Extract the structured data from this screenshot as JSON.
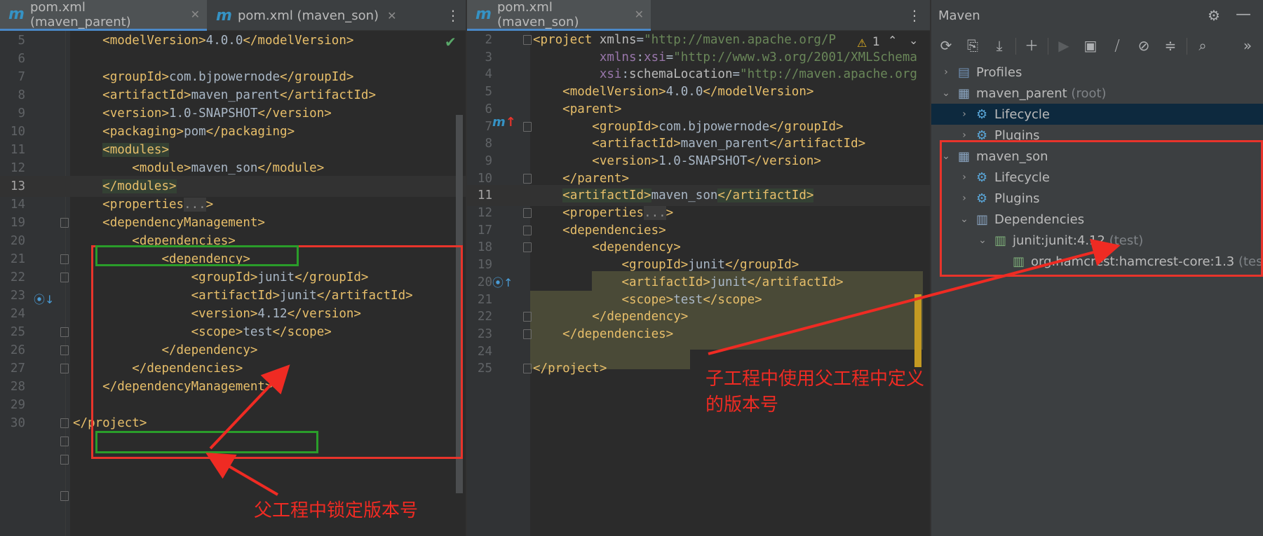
{
  "left_pane": {
    "tabs": [
      {
        "label": "pom.xml (maven_parent)",
        "active": true
      },
      {
        "label": "pom.xml (maven_son)",
        "active": false
      }
    ],
    "lines": [
      {
        "n": "5",
        "html": "    <span class=\"t-tag\">&lt;modelVersion&gt;</span>4.0.0<span class=\"t-tag\">&lt;/modelVersion&gt;</span>"
      },
      {
        "n": "6",
        "html": ""
      },
      {
        "n": "7",
        "html": "    <span class=\"t-tag\">&lt;groupId&gt;</span>com.bjpowernode<span class=\"t-tag\">&lt;/groupId&gt;</span>"
      },
      {
        "n": "8",
        "html": "    <span class=\"t-tag\">&lt;artifactId&gt;</span>maven_parent<span class=\"t-tag\">&lt;/artifactId&gt;</span>"
      },
      {
        "n": "9",
        "html": "    <span class=\"t-tag\">&lt;version&gt;</span>1.0-SNAPSHOT<span class=\"t-tag\">&lt;/version&gt;</span>"
      },
      {
        "n": "10",
        "html": "    <span class=\"t-tag\">&lt;packaging&gt;</span>pom<span class=\"t-tag\">&lt;/packaging&gt;</span>"
      },
      {
        "n": "11",
        "html": "    <span class=\"t-tag t-hl\">&lt;modules&gt;</span>"
      },
      {
        "n": "12",
        "html": "        <span class=\"t-tag\">&lt;module&gt;</span>maven_son<span class=\"t-tag\">&lt;/module&gt;</span>"
      },
      {
        "n": "13",
        "html": "    <span class=\"t-tag t-hl\">&lt;/modules&gt;</span>",
        "current": true
      },
      {
        "n": "14",
        "html": "    <span class=\"t-tag\">&lt;properties</span><span class=\"t-fold\">...</span><span class=\"t-tag\">&gt;</span>"
      },
      {
        "n": "19",
        "html": "    <span class=\"t-tag\">&lt;dependencyManagement&gt;</span>"
      },
      {
        "n": "20",
        "html": "        <span class=\"t-tag\">&lt;dependencies&gt;</span>"
      },
      {
        "n": "21",
        "html": "            <span class=\"t-tag\">&lt;dependency&gt;</span>"
      },
      {
        "n": "22",
        "html": "                <span class=\"t-tag\">&lt;groupId&gt;</span>junit<span class=\"t-tag\">&lt;/groupId&gt;</span>"
      },
      {
        "n": "23",
        "html": "                <span class=\"t-tag\">&lt;artifactId&gt;</span>junit<span class=\"t-tag\">&lt;/artifactId&gt;</span>"
      },
      {
        "n": "24",
        "html": "                <span class=\"t-tag\">&lt;version&gt;</span>4.12<span class=\"t-tag\">&lt;/version&gt;</span>"
      },
      {
        "n": "25",
        "html": "                <span class=\"t-tag\">&lt;scope&gt;</span>test<span class=\"t-tag\">&lt;/scope&gt;</span>"
      },
      {
        "n": "26",
        "html": "            <span class=\"t-tag\">&lt;/dependency&gt;</span>"
      },
      {
        "n": "27",
        "html": "        <span class=\"t-tag\">&lt;/dependencies&gt;</span>"
      },
      {
        "n": "28",
        "html": "    <span class=\"t-tag\">&lt;/dependencyManagement&gt;</span>"
      },
      {
        "n": "29",
        "html": ""
      },
      {
        "n": "30",
        "html": "<span class=\"t-tag\">&lt;/project&gt;</span>"
      }
    ],
    "annotation": "父工程中锁定版本号"
  },
  "mid_pane": {
    "tabs": [
      {
        "label": "pom.xml (maven_son)",
        "active": true
      }
    ],
    "warning_count": "1",
    "lines": [
      {
        "n": "2",
        "html": "<span class=\"t-tag\">&lt;project</span> <span class=\"t-attr\">xmlns</span>=<span class=\"t-val\">\"http://maven.apache.org/P</span>"
      },
      {
        "n": "3",
        "html": "         <span class=\"t-ns\">xmlns</span>:<span class=\"t-ns\">xsi</span>=<span class=\"t-val\">\"http://www.w3.org/2001/XMLSchema</span>"
      },
      {
        "n": "4",
        "html": "         <span class=\"t-ns\">xsi</span>:<span class=\"t-attr\">schemaLocation</span>=<span class=\"t-val\">\"http://maven.apache.org</span>"
      },
      {
        "n": "5",
        "html": "    <span class=\"t-tag\">&lt;modelVersion&gt;</span>4.0.0<span class=\"t-tag\">&lt;/modelVersion&gt;</span>"
      },
      {
        "n": "6",
        "html": "    <span class=\"t-tag\">&lt;parent&gt;</span>"
      },
      {
        "n": "7",
        "html": "        <span class=\"t-tag\">&lt;groupId&gt;</span>com.bjpowernode<span class=\"t-tag\">&lt;/groupId&gt;</span>"
      },
      {
        "n": "8",
        "html": "        <span class=\"t-tag\">&lt;artifactId&gt;</span>maven_parent<span class=\"t-tag\">&lt;/artifactId&gt;</span>"
      },
      {
        "n": "9",
        "html": "        <span class=\"t-tag\">&lt;version&gt;</span>1.0-SNAPSHOT<span class=\"t-tag\">&lt;/version&gt;</span>"
      },
      {
        "n": "10",
        "html": "    <span class=\"t-tag\">&lt;/parent&gt;</span>"
      },
      {
        "n": "11",
        "html": "    <span class=\"t-tag t-hl\">&lt;artifactId&gt;</span>maven_son<span class=\"t-tag t-hl\">&lt;/artifactId&gt;</span>",
        "current": true
      },
      {
        "n": "12",
        "html": "    <span class=\"t-tag\">&lt;properties</span><span class=\"t-fold\">...</span><span class=\"t-tag\">&gt;</span>"
      },
      {
        "n": "17",
        "html": "    <span class=\"t-tag\">&lt;dependencies&gt;</span>"
      },
      {
        "n": "18",
        "html": "        <span class=\"t-tag\">&lt;dependency&gt;</span>"
      },
      {
        "n": "19",
        "html": "            <span class=\"t-tag\">&lt;groupId&gt;</span>junit<span class=\"t-tag\">&lt;/groupId&gt;</span>"
      },
      {
        "n": "20",
        "html": "            <span class=\"t-tag\">&lt;artifactId&gt;</span>junit<span class=\"t-tag\">&lt;/artifactId&gt;</span>"
      },
      {
        "n": "21",
        "html": "            <span class=\"t-tag\">&lt;scope&gt;</span>test<span class=\"t-tag\">&lt;/scope&gt;</span>"
      },
      {
        "n": "22",
        "html": "        <span class=\"t-tag\">&lt;/dependency&gt;</span>"
      },
      {
        "n": "23",
        "html": "    <span class=\"t-tag\">&lt;/dependencies&gt;</span>"
      },
      {
        "n": "24",
        "html": ""
      },
      {
        "n": "25",
        "html": "<span class=\"t-tag\">&lt;/project&gt;</span>"
      }
    ],
    "annotation": "子工程中使用父工程中定义的版本号"
  },
  "maven_panel": {
    "title": "Maven",
    "tree": [
      {
        "label": "Profiles",
        "suffix": "",
        "level": 0,
        "chev": "right",
        "icon": "profiles-icon"
      },
      {
        "label": "maven_parent",
        "suffix": "(root)",
        "level": 0,
        "chev": "down",
        "icon": "maven-module-icon"
      },
      {
        "label": "Lifecycle",
        "suffix": "",
        "level": 1,
        "chev": "right",
        "icon": "lifecycle-icon",
        "selected": true
      },
      {
        "label": "Plugins",
        "suffix": "",
        "level": 1,
        "chev": "right",
        "icon": "plugins-icon"
      },
      {
        "label": "maven_son",
        "suffix": "",
        "level": 0,
        "chev": "down",
        "icon": "maven-module-icon"
      },
      {
        "label": "Lifecycle",
        "suffix": "",
        "level": 1,
        "chev": "right",
        "icon": "lifecycle-icon"
      },
      {
        "label": "Plugins",
        "suffix": "",
        "level": 1,
        "chev": "right",
        "icon": "plugins-icon"
      },
      {
        "label": "Dependencies",
        "suffix": "",
        "level": 1,
        "chev": "down",
        "icon": "dependencies-icon"
      },
      {
        "label": "junit:junit:4.12",
        "suffix": "(test)",
        "level": 2,
        "chev": "down",
        "icon": "library-icon"
      },
      {
        "label": "org.hamcrest:hamcrest-core:1.3",
        "suffix": "(test)",
        "level": 3,
        "chev": "",
        "icon": "library-icon"
      }
    ]
  },
  "colors": {
    "annotation_red": "#ef2b23",
    "box_green": "#2a9d2a",
    "tag": "#e8bf6a",
    "string": "#6a8759"
  }
}
